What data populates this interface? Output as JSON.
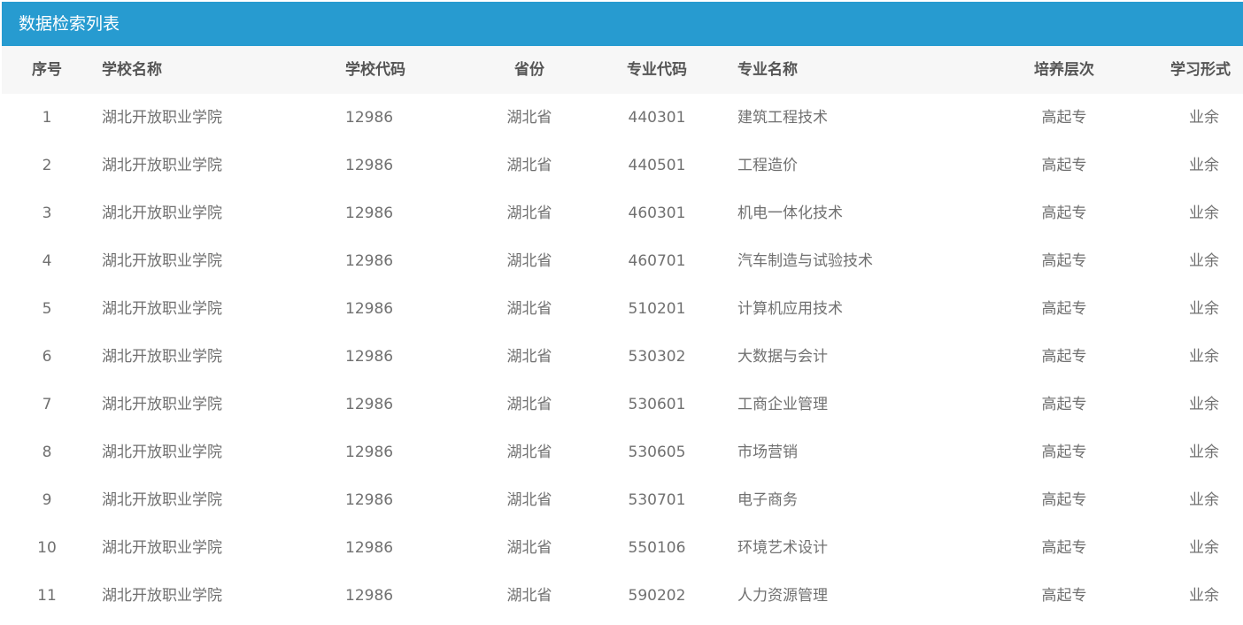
{
  "panel": {
    "title": "数据检索列表"
  },
  "columns": {
    "idx": "序号",
    "school": "学校名称",
    "school_code": "学校代码",
    "province": "省份",
    "major_code": "专业代码",
    "major_name": "专业名称",
    "level": "培养层次",
    "mode": "学习形式"
  },
  "rows": [
    {
      "idx": "1",
      "school": "湖北开放职业学院",
      "school_code": "12986",
      "province": "湖北省",
      "major_code": "440301",
      "major_name": "建筑工程技术",
      "level": "高起专",
      "mode": "业余"
    },
    {
      "idx": "2",
      "school": "湖北开放职业学院",
      "school_code": "12986",
      "province": "湖北省",
      "major_code": "440501",
      "major_name": "工程造价",
      "level": "高起专",
      "mode": "业余"
    },
    {
      "idx": "3",
      "school": "湖北开放职业学院",
      "school_code": "12986",
      "province": "湖北省",
      "major_code": "460301",
      "major_name": "机电一体化技术",
      "level": "高起专",
      "mode": "业余"
    },
    {
      "idx": "4",
      "school": "湖北开放职业学院",
      "school_code": "12986",
      "province": "湖北省",
      "major_code": "460701",
      "major_name": "汽车制造与试验技术",
      "level": "高起专",
      "mode": "业余"
    },
    {
      "idx": "5",
      "school": "湖北开放职业学院",
      "school_code": "12986",
      "province": "湖北省",
      "major_code": "510201",
      "major_name": "计算机应用技术",
      "level": "高起专",
      "mode": "业余"
    },
    {
      "idx": "6",
      "school": "湖北开放职业学院",
      "school_code": "12986",
      "province": "湖北省",
      "major_code": "530302",
      "major_name": "大数据与会计",
      "level": "高起专",
      "mode": "业余"
    },
    {
      "idx": "7",
      "school": "湖北开放职业学院",
      "school_code": "12986",
      "province": "湖北省",
      "major_code": "530601",
      "major_name": "工商企业管理",
      "level": "高起专",
      "mode": "业余"
    },
    {
      "idx": "8",
      "school": "湖北开放职业学院",
      "school_code": "12986",
      "province": "湖北省",
      "major_code": "530605",
      "major_name": "市场营销",
      "level": "高起专",
      "mode": "业余"
    },
    {
      "idx": "9",
      "school": "湖北开放职业学院",
      "school_code": "12986",
      "province": "湖北省",
      "major_code": "530701",
      "major_name": "电子商务",
      "level": "高起专",
      "mode": "业余"
    },
    {
      "idx": "10",
      "school": "湖北开放职业学院",
      "school_code": "12986",
      "province": "湖北省",
      "major_code": "550106",
      "major_name": "环境艺术设计",
      "level": "高起专",
      "mode": "业余"
    },
    {
      "idx": "11",
      "school": "湖北开放职业学院",
      "school_code": "12986",
      "province": "湖北省",
      "major_code": "590202",
      "major_name": "人力资源管理",
      "level": "高起专",
      "mode": "业余"
    }
  ],
  "colors": {
    "header_bg": "#279bd0",
    "thead_bg": "#f7f7f7",
    "text": "#707070"
  }
}
